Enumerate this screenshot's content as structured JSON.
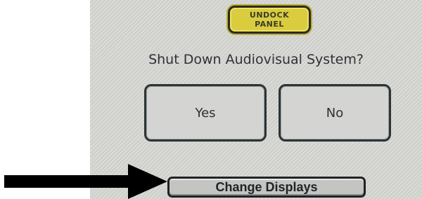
{
  "undock_panel": {
    "line1": "UNDOCK",
    "line2": "PANEL"
  },
  "prompt": "Shut Down Audiovisual System?",
  "buttons": {
    "yes": "Yes",
    "no": "No"
  },
  "change_displays": "Change Displays",
  "colors": {
    "screen_bg": "#d6d6d3",
    "undock_yellow": "#d9cc3e",
    "border_dark": "#2d3436",
    "arrow": "#000000"
  },
  "icons": {
    "pointer": "arrow-right-icon"
  }
}
